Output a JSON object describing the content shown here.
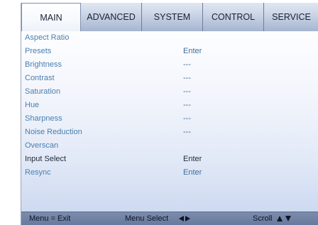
{
  "tabs": [
    {
      "label": "MAIN",
      "active": true
    },
    {
      "label": "ADVANCED",
      "active": false
    },
    {
      "label": "SYSTEM",
      "active": false
    },
    {
      "label": "CONTROL",
      "active": false
    },
    {
      "label": "SERVICE",
      "active": false
    }
  ],
  "menu": {
    "items": [
      {
        "label": "Aspect Ratio",
        "value": ""
      },
      {
        "label": "Presets",
        "value": "Enter"
      },
      {
        "label": "Brightness",
        "value": "---"
      },
      {
        "label": "Contrast",
        "value": "---"
      },
      {
        "label": "Saturation",
        "value": "---"
      },
      {
        "label": "Hue",
        "value": "---"
      },
      {
        "label": "Sharpness",
        "value": "---"
      },
      {
        "label": "Noise Reduction",
        "value": "---"
      },
      {
        "label": "Overscan",
        "value": ""
      },
      {
        "label": "Input Select",
        "value": "Enter"
      },
      {
        "label": "Resync",
        "value": "Enter"
      }
    ]
  },
  "footer": {
    "exit_hint": "Menu = Exit",
    "select_hint": "Menu Select",
    "scroll_hint": "Scroll"
  },
  "colors": {
    "item_text": "#4a7fae",
    "highlight_text": "#1f2a3a",
    "footer_bg": "#6f81a3"
  }
}
